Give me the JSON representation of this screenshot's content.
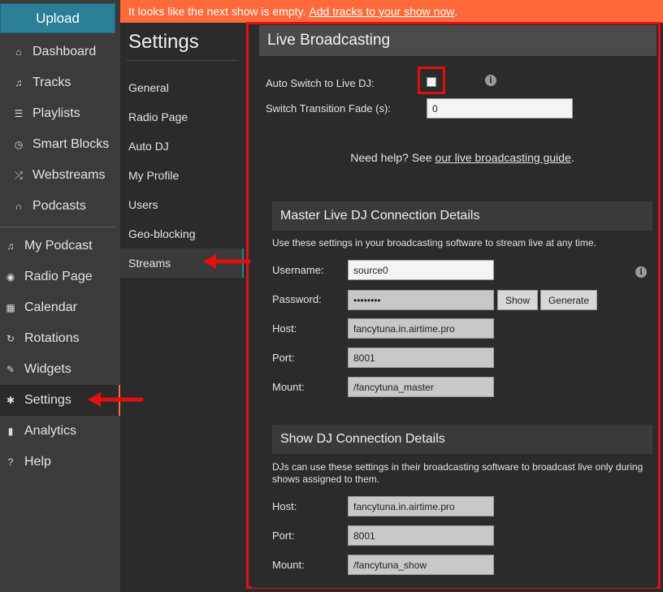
{
  "left_nav": {
    "upload_label": "Upload",
    "items": [
      {
        "label": "Dashboard",
        "icon": "home-icon",
        "glyph": "⌂"
      },
      {
        "label": "Tracks",
        "icon": "music-note-icon",
        "glyph": "♫"
      },
      {
        "label": "Playlists",
        "icon": "list-icon",
        "glyph": "☰"
      },
      {
        "label": "Smart Blocks",
        "icon": "clock-icon",
        "glyph": "◷"
      },
      {
        "label": "Webstreams",
        "icon": "shuffle-icon",
        "glyph": "⤮"
      },
      {
        "label": "Podcasts",
        "icon": "headphones-icon",
        "glyph": "∩"
      },
      {
        "label": "My Podcast",
        "icon": "music-note-icon",
        "glyph": "♫"
      },
      {
        "label": "Radio Page",
        "icon": "globe-icon",
        "glyph": "◉"
      },
      {
        "label": "Calendar",
        "icon": "calendar-icon",
        "glyph": "▦"
      },
      {
        "label": "Rotations",
        "icon": "refresh-icon",
        "glyph": "↻"
      },
      {
        "label": "Widgets",
        "icon": "wrench-icon",
        "glyph": "✎"
      },
      {
        "label": "Settings",
        "icon": "gear-icon",
        "glyph": "✱"
      },
      {
        "label": "Analytics",
        "icon": "bar-chart-icon",
        "glyph": "▮"
      },
      {
        "label": "Help",
        "icon": "question-icon",
        "glyph": "?"
      }
    ]
  },
  "notice": {
    "text": "It looks like the next show is empty.",
    "link": "Add tracks to your show now",
    "suffix": "."
  },
  "settings_nav": {
    "title": "Settings",
    "items": [
      "General",
      "Radio Page",
      "Auto DJ",
      "My Profile",
      "Users",
      "Geo-blocking",
      "Streams"
    ],
    "active": "Streams"
  },
  "live": {
    "title": "Live Broadcasting",
    "auto_switch_label": "Auto Switch to Live DJ:",
    "auto_switch_checked": false,
    "fade_label": "Switch Transition Fade (s):",
    "fade_value": "0",
    "help_text": "Need help? See",
    "help_link": "our live broadcasting guide",
    "help_suffix": "."
  },
  "master": {
    "title": "Master Live DJ Connection Details",
    "desc": "Use these settings in your broadcasting software to stream live at any time.",
    "username_label": "Username:",
    "username": "source0",
    "password_label": "Password:",
    "password": "••••••••",
    "show_label": "Show",
    "generate_label": "Generate",
    "host_label": "Host:",
    "host": "fancytuna.in.airtime.pro",
    "port_label": "Port:",
    "port": "8001",
    "mount_label": "Mount:",
    "mount": "/fancytuna_master"
  },
  "show_dj": {
    "title": "Show DJ Connection Details",
    "desc": "DJs can use these settings in their broadcasting software to broadcast live only during shows assigned to them.",
    "host_label": "Host:",
    "host": "fancytuna.in.airtime.pro",
    "port_label": "Port:",
    "port": "8001",
    "mount_label": "Mount:",
    "mount": "/fancytuna_show"
  },
  "colors": {
    "accent": "#2a7f97",
    "notice": "#ff6a3a",
    "highlight": "#e01010"
  }
}
